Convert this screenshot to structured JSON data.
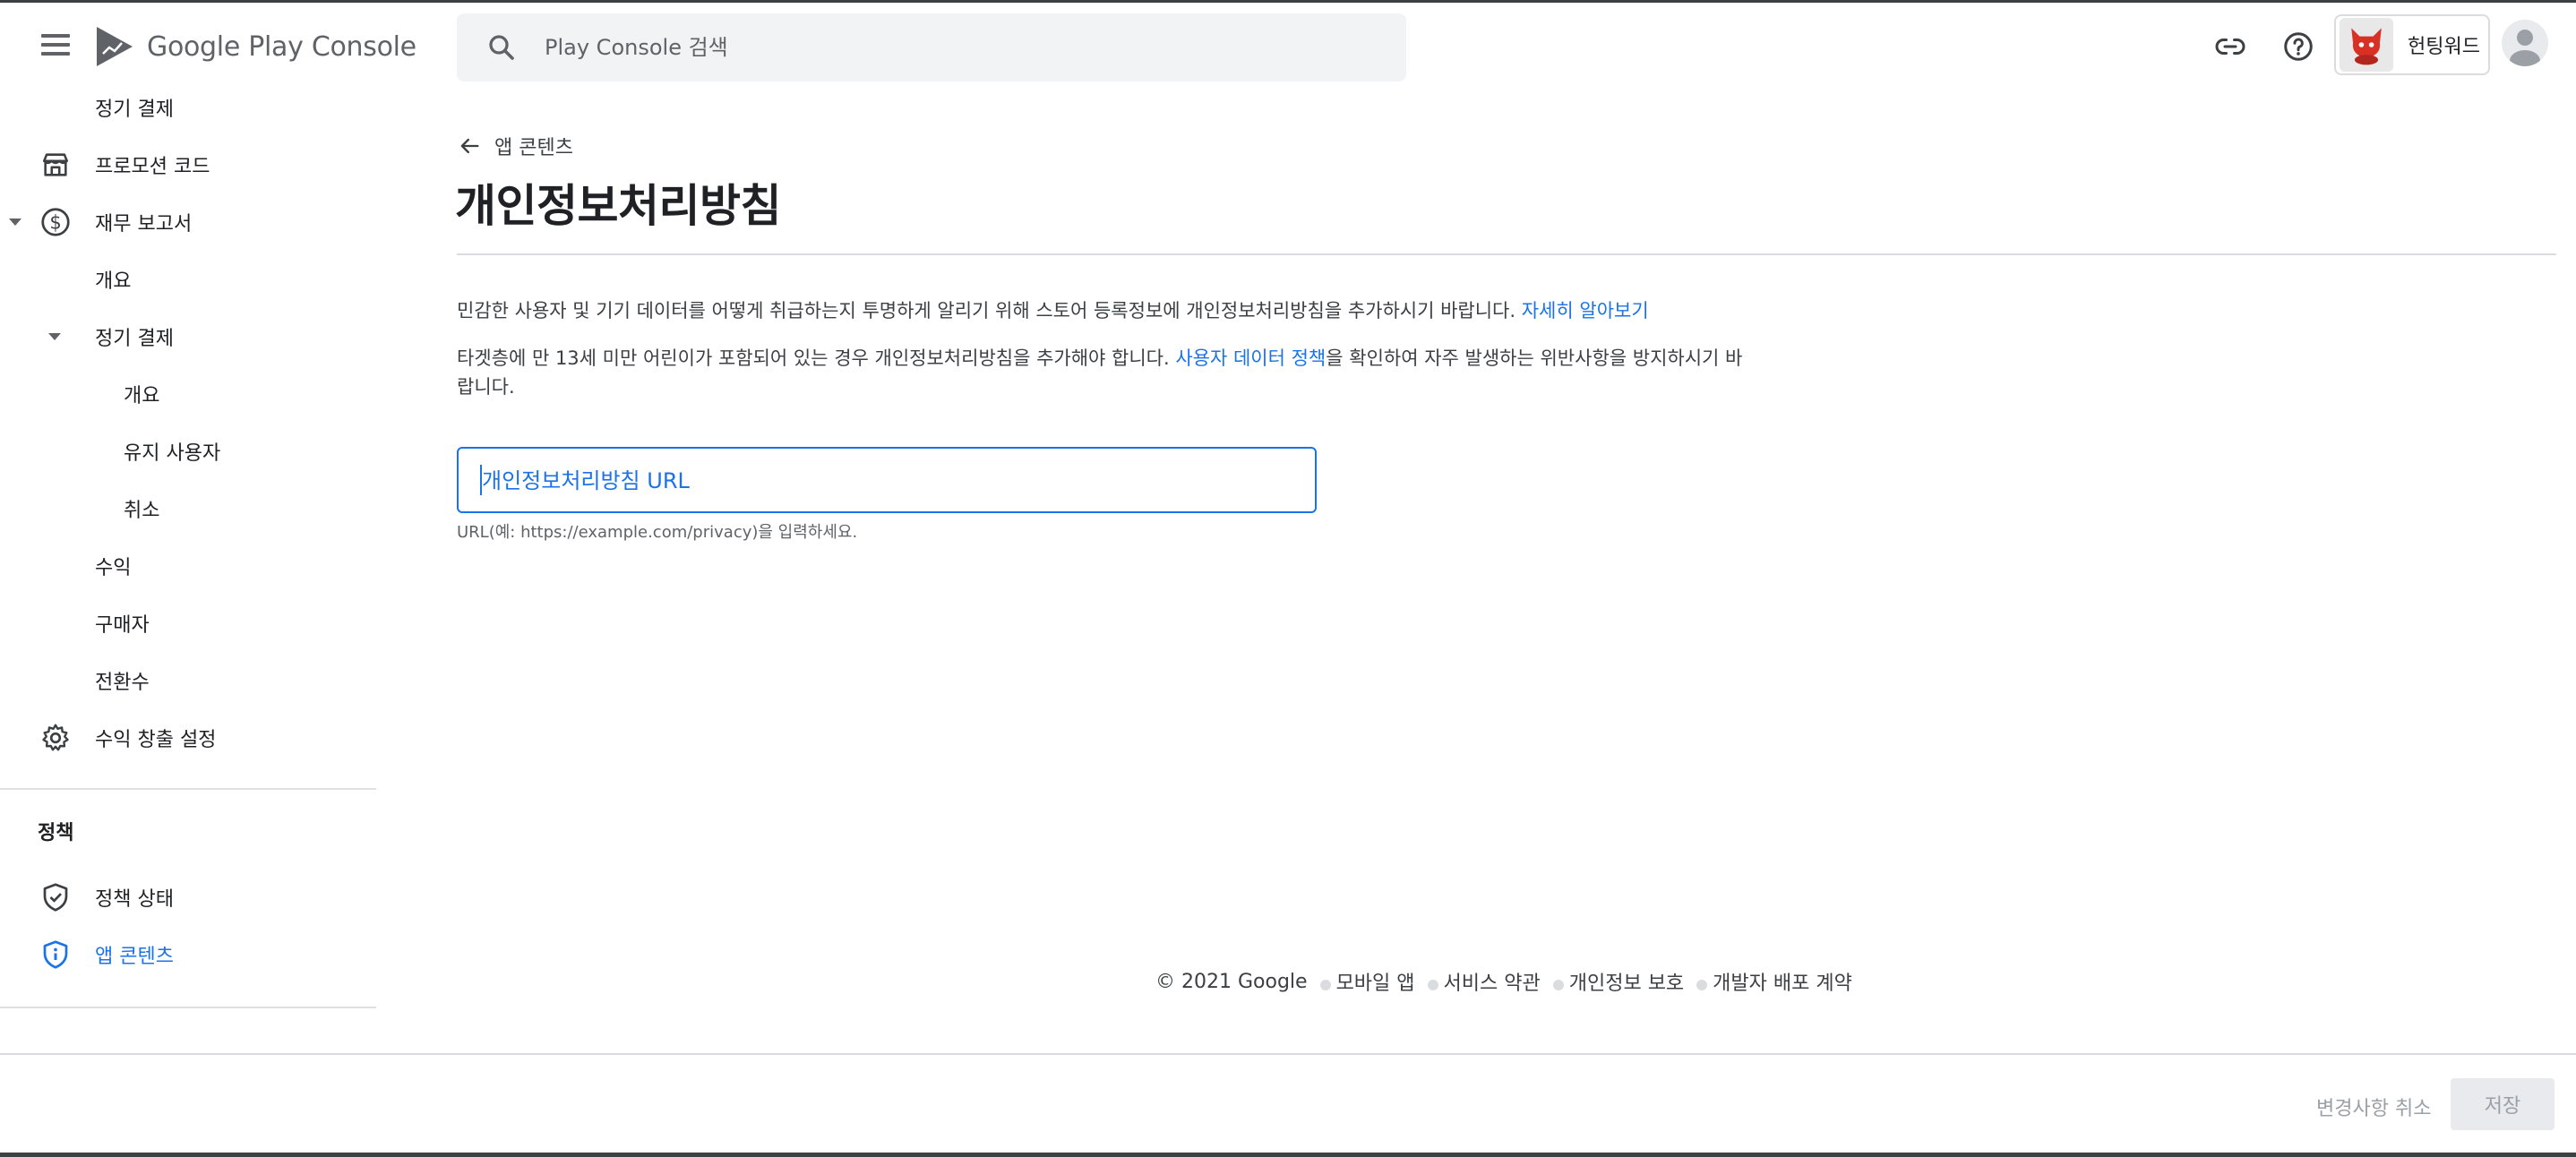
{
  "app": {
    "logo_text": "Google Play Console"
  },
  "search": {
    "placeholder": "Play Console 검색"
  },
  "account": {
    "name": "헌팅워드"
  },
  "sidebar": {
    "items": [
      {
        "label": "정기 결제"
      },
      {
        "label": "프로모션 코드",
        "icon": "store-icon"
      },
      {
        "label": "재무 보고서",
        "icon": "dollar-circle-icon"
      },
      {
        "label": "개요"
      },
      {
        "label": "정기 결제"
      },
      {
        "label": "개요"
      },
      {
        "label": "유지 사용자"
      },
      {
        "label": "취소"
      },
      {
        "label": "수익"
      },
      {
        "label": "구매자"
      },
      {
        "label": "전환수"
      },
      {
        "label": "수익 창출 설정",
        "icon": "gear-icon"
      }
    ],
    "policy_header": "정책",
    "policy_items": [
      {
        "label": "정책 상태",
        "icon": "shield-check-icon"
      },
      {
        "label": "앱 콘텐츠",
        "icon": "shield-info-icon",
        "active": true
      }
    ]
  },
  "main": {
    "back_label": "앱 콘텐츠",
    "title": "개인정보처리방침",
    "para1_text": "민감한 사용자 및 기기 데이터를 어떻게 취급하는지 투명하게 알리기 위해 스토어 등록정보에 개인정보처리방침을 추가하시기 바랍니다. ",
    "para1_link": "자세히 알아보기",
    "para2_text_a": "타겟층에 만 13세 미만 어린이가 포함되어 있는 경우 개인정보처리방침을 추가해야 합니다. ",
    "para2_link": "사용자 데이터 정책",
    "para2_text_b": "을 확인하여 자주 발생하는 위반사항을 방지하시기 바랍니다.",
    "url_placeholder": "개인정보처리방침 URL",
    "url_value": "",
    "url_hint": "URL(예: https://example.com/privacy)을 입력하세요."
  },
  "footer": {
    "copyright": "© 2021 Google",
    "links": [
      "모바일 앱",
      "서비스 약관",
      "개인정보 보호",
      "개발자 배포 계약"
    ]
  },
  "actions": {
    "cancel_label": "변경사항 취소",
    "save_label": "저장"
  },
  "colors": {
    "accent": "#1a73e8",
    "text": "#202124",
    "muted": "#5f6368"
  }
}
